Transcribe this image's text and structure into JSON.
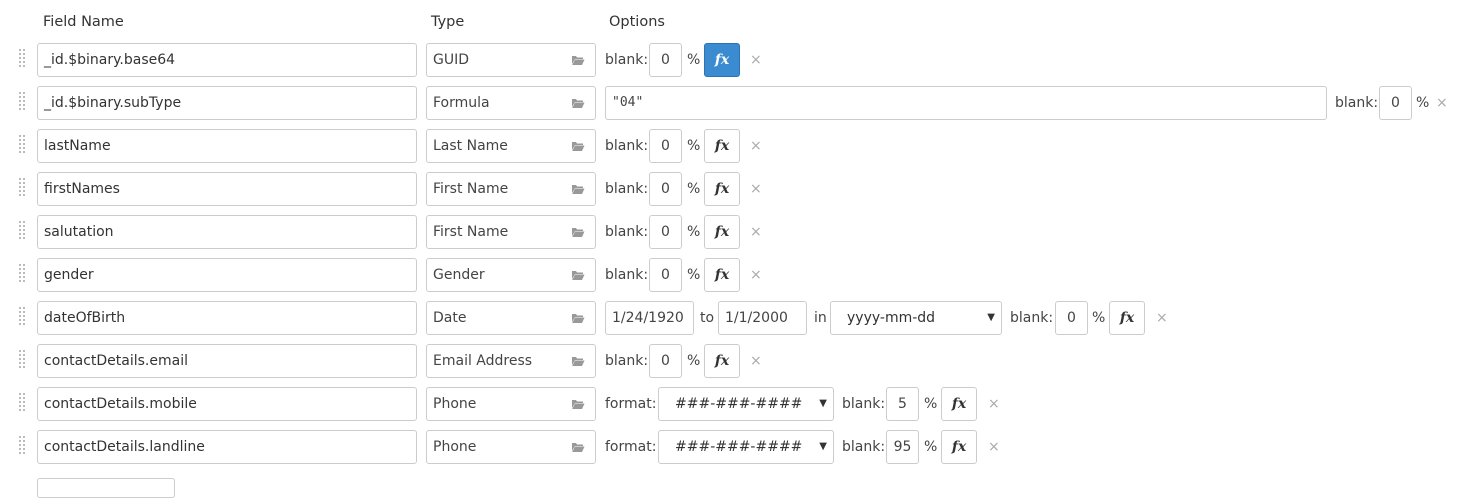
{
  "headers": {
    "field_name": "Field Name",
    "type": "Type",
    "options": "Options"
  },
  "labels": {
    "blank": "blank:",
    "percent": "%",
    "format": "format:",
    "to": "to",
    "in": "in",
    "remove": "×",
    "fx": "fx"
  },
  "rows": [
    {
      "field": "_id.$binary.base64",
      "type": "GUID",
      "blank": "0"
    },
    {
      "field": "_id.$binary.subType",
      "type": "Formula",
      "formula": "\"04\"",
      "blank": "0"
    },
    {
      "field": "lastName",
      "type": "Last Name",
      "blank": "0"
    },
    {
      "field": "firstNames",
      "type": "First Name",
      "blank": "0"
    },
    {
      "field": "salutation",
      "type": "First Name",
      "blank": "0"
    },
    {
      "field": "gender",
      "type": "Gender",
      "blank": "0"
    },
    {
      "field": "dateOfBirth",
      "type": "Date",
      "from": "1/24/1920",
      "to": "1/1/2000",
      "date_format": "yyyy-mm-dd",
      "blank": "0"
    },
    {
      "field": "contactDetails.email",
      "type": "Email Address",
      "blank": "0"
    },
    {
      "field": "contactDetails.mobile",
      "type": "Phone",
      "format": "###-###-####",
      "blank": "5"
    },
    {
      "field": "contactDetails.landline",
      "type": "Phone",
      "format": "###-###-####",
      "blank": "95"
    }
  ],
  "colors": {
    "fx_active": "#3b8bd0",
    "border": "#cccccc"
  },
  "icons": {
    "handle": "drag-handle-icon",
    "type_button": "folder-icon",
    "remove": "close-icon"
  }
}
